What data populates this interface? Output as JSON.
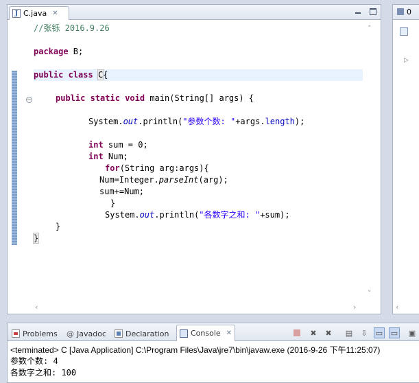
{
  "editor": {
    "tab_label": "C.java",
    "code_lines": {
      "l1_comment": "//张铄 2016.9.26",
      "l2_kw": "package",
      "l2_rest": " B;",
      "l3_kw1": "public",
      "l3_kw2": "class",
      "l3_cls": "C",
      "l3_rest": "{",
      "l4_kw1": "public",
      "l4_kw2": "static",
      "l4_kw3": "void",
      "l4_rest": " main(String[] args) {",
      "l5_a": "System.",
      "l5_out": "out",
      "l5_b": ".println(",
      "l5_str": "\"参数个数: \"",
      "l5_c": "+args.",
      "l5_len": "length",
      "l5_d": ");",
      "l6_kw": "int",
      "l6_rest": " sum = 0;",
      "l7_kw": "int",
      "l7_rest": " Num;",
      "l8_kw": "for",
      "l8_rest": "(String arg:args){",
      "l9_a": "Num=Integer.",
      "l9_m": "parseInt",
      "l9_b": "(arg);",
      "l10": "sum+=Num;",
      "l11": "}",
      "l12_a": "System.",
      "l12_out": "out",
      "l12_b": ".println(",
      "l12_str": "\"各数字之和: \"",
      "l12_c": "+sum);",
      "l13": "}",
      "l14": "}"
    }
  },
  "outline": {
    "tab_label": "0"
  },
  "console_view": {
    "tabs": {
      "problems": "Problems",
      "javadoc": "Javadoc",
      "declaration": "Declaration",
      "console": "Console"
    },
    "status": "<terminated> C [Java Application] C:\\Program Files\\Java\\jre7\\bin\\javaw.exe (2016-9-26 下午11:25:07)",
    "output": [
      "参数个数: 4",
      "各数字之和: 100"
    ]
  }
}
